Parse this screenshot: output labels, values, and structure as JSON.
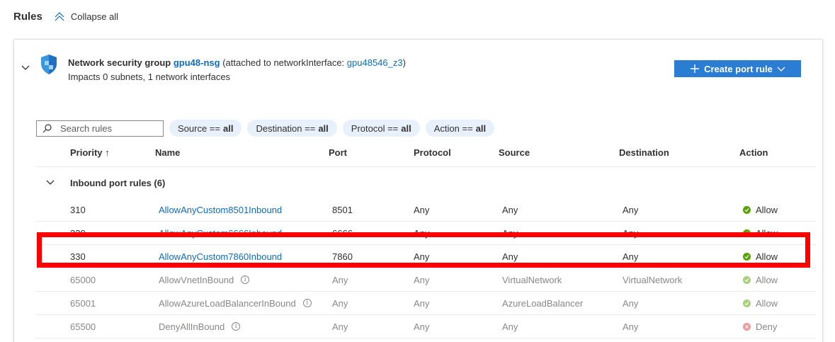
{
  "header": {
    "title": "Rules",
    "collapse_all_label": "Collapse all"
  },
  "nsg": {
    "label": "Network security group",
    "name": "gpu48-nsg",
    "attached_prefix": "(attached to networkInterface:",
    "nic_name": "gpu48546_z3",
    "attached_suffix": ")",
    "impacts": "Impacts 0 subnets, 1 network interfaces"
  },
  "create_button_label": "Create port rule",
  "search": {
    "placeholder": "Search rules",
    "value": ""
  },
  "filters": [
    {
      "label": "Source ==",
      "value": "all"
    },
    {
      "label": "Destination ==",
      "value": "all"
    },
    {
      "label": "Protocol ==",
      "value": "all"
    },
    {
      "label": "Action ==",
      "value": "all"
    }
  ],
  "columns": {
    "priority": "Priority ↑",
    "name": "Name",
    "port": "Port",
    "protocol": "Protocol",
    "source": "Source",
    "destination": "Destination",
    "action": "Action"
  },
  "group": {
    "label": "Inbound port rules (6)"
  },
  "rules": [
    {
      "priority": "310",
      "name": "AllowAnyCustom8501Inbound",
      "port": "8501",
      "protocol": "Any",
      "source": "Any",
      "destination": "Any",
      "action": "Allow"
    },
    {
      "priority": "320",
      "name": "AllowAnyCustom6666Inbound",
      "port": "6666",
      "protocol": "Any",
      "source": "Any",
      "destination": "Any",
      "action": "Allow"
    },
    {
      "priority": "330",
      "name": "AllowAnyCustom7860Inbound",
      "port": "7860",
      "protocol": "Any",
      "source": "Any",
      "destination": "Any",
      "action": "Allow"
    },
    {
      "priority": "65000",
      "name": "AllowVnetInBound",
      "port": "Any",
      "protocol": "Any",
      "source": "VirtualNetwork",
      "destination": "VirtualNetwork",
      "action": "Allow"
    },
    {
      "priority": "65001",
      "name": "AllowAzureLoadBalancerInBound",
      "port": "Any",
      "protocol": "Any",
      "source": "AzureLoadBalancer",
      "destination": "Any",
      "action": "Allow"
    },
    {
      "priority": "65500",
      "name": "DenyAllInBound",
      "port": "Any",
      "protocol": "Any",
      "source": "Any",
      "destination": "Any",
      "action": "Deny"
    }
  ],
  "colors": {
    "accent": "#2b7cd3",
    "link": "#0f6cbd",
    "allow": "#57a300",
    "deny": "#e64a4a",
    "highlight": "#ff0000"
  }
}
